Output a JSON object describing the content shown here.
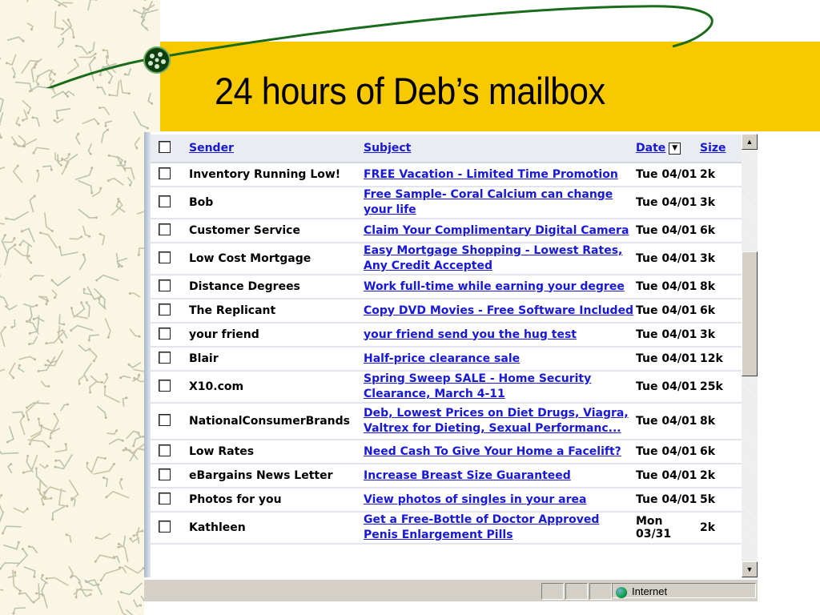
{
  "slide": {
    "title": "24 hours of Deb’s mailbox"
  },
  "colors": {
    "band": "#f8c800",
    "link": "#1818d8",
    "swoosh": "#1a6b1a"
  },
  "mail_table": {
    "columns": {
      "sender": "Sender",
      "subject": "Subject",
      "date": "Date",
      "size": "Size"
    },
    "rows": [
      {
        "sender": "Inventory Running Low!",
        "subject": "FREE Vacation - Limited Time Promotion",
        "date": "Tue 04/01",
        "size": "2k"
      },
      {
        "sender": "Bob",
        "subject": "Free Sample- Coral Calcium can change your life",
        "date": "Tue 04/01",
        "size": "3k"
      },
      {
        "sender": "Customer Service",
        "subject": "Claim Your Complimentary Digital Camera",
        "date": "Tue 04/01",
        "size": "6k"
      },
      {
        "sender": "Low Cost Mortgage",
        "subject": "Easy Mortgage Shopping - Lowest Rates, Any Credit Accepted",
        "date": "Tue 04/01",
        "size": "3k"
      },
      {
        "sender": "Distance Degrees",
        "subject": "Work full-time while earning your degree",
        "date": "Tue 04/01",
        "size": "8k"
      },
      {
        "sender": "The Replicant",
        "subject": "Copy DVD Movies - Free Software Included",
        "date": "Tue 04/01",
        "size": "6k"
      },
      {
        "sender": "your friend",
        "subject": "your friend send you the hug test",
        "date": "Tue 04/01",
        "size": "3k"
      },
      {
        "sender": "Blair",
        "subject": "Half-price clearance sale",
        "date": "Tue 04/01",
        "size": "12k"
      },
      {
        "sender": "X10.com",
        "subject": "Spring Sweep SALE - Home Security Clearance, March 4-11",
        "date": "Tue 04/01",
        "size": "25k"
      },
      {
        "sender": "NationalConsumerBrands",
        "subject": "Deb, Lowest Prices on Diet Drugs, Viagra, Valtrex for Dieting, Sexual Performanc...",
        "date": "Tue 04/01",
        "size": "8k"
      },
      {
        "sender": "Low Rates",
        "subject": "Need Cash To Give Your Home a Facelift?",
        "date": "Tue 04/01",
        "size": "6k"
      },
      {
        "sender": "eBargains News Letter",
        "subject": "Increase Breast Size Guaranteed",
        "date": "Tue 04/01",
        "size": "2k"
      },
      {
        "sender": "Photos for you",
        "subject": "View photos of singles in your area",
        "date": "Tue 04/01",
        "size": "5k"
      },
      {
        "sender": "Kathleen",
        "subject": "Get a Free-Bottle of Doctor Approved Penis Enlargement Pills",
        "date": "Mon 03/31",
        "size": "2k"
      }
    ]
  },
  "status_bar": {
    "zone": "Internet",
    "zone_icon": "globe-icon"
  },
  "scrollbar": {
    "position": 0.35
  }
}
